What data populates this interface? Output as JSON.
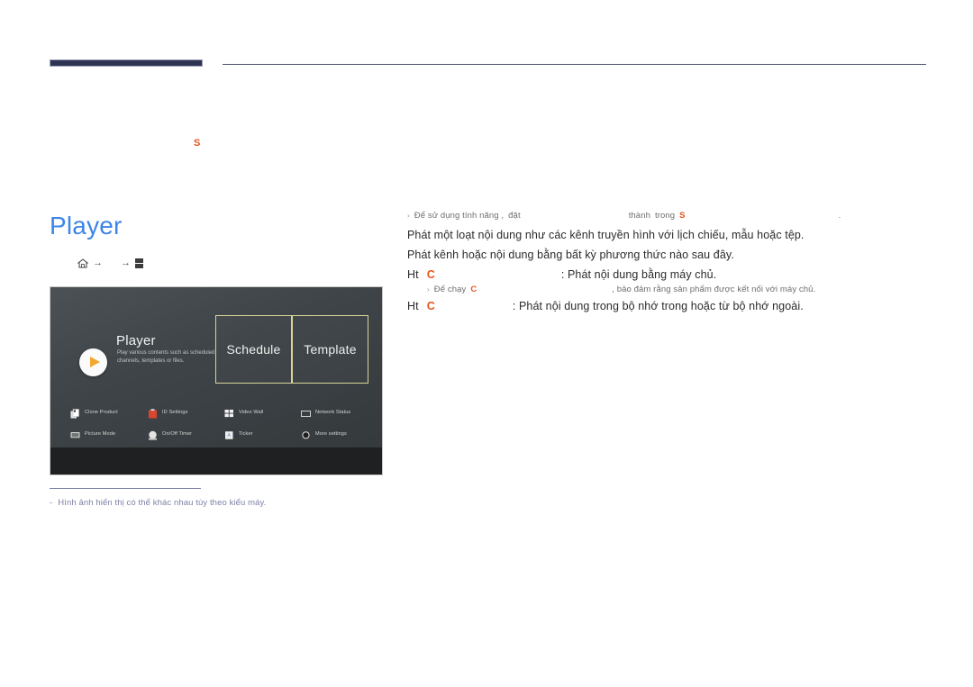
{
  "header": {
    "chapter_mark": "S",
    "bar_color": "#2e3352",
    "rule_color": "#4c5070"
  },
  "page": {
    "title": "Player",
    "title_color": "#3d85e8"
  },
  "breadcrumb": {
    "home_icon": "home-icon",
    "arrow1": "→",
    "arrow2": "→",
    "enter_icon": "enter-key-icon"
  },
  "screenshot": {
    "hero": {
      "title": "Player",
      "description": "Play various contents such as scheduled channels, templates or files.",
      "play_icon": "play-icon"
    },
    "tiles": [
      {
        "label": "Schedule"
      },
      {
        "label": "Template"
      }
    ],
    "grid_items": [
      {
        "label": "Clone Product",
        "icon": "clone-product-icon"
      },
      {
        "label": "ID Settings",
        "icon": "id-settings-icon"
      },
      {
        "label": "Video Wall",
        "icon": "video-wall-icon"
      },
      {
        "label": "Network Status",
        "icon": "network-status-icon"
      },
      {
        "label": "Picture Mode",
        "icon": "picture-mode-icon"
      },
      {
        "label": "On/Off Timer",
        "icon": "on-off-timer-icon"
      },
      {
        "label": "Ticker",
        "icon": "ticker-icon"
      },
      {
        "label": "More settings",
        "icon": "more-settings-icon"
      }
    ],
    "accent_border": "#d8d49a",
    "play_accent": "#f0a830"
  },
  "caption": {
    "dash": "-",
    "text": "Hình ảnh hiển thị có thể khác nhau tùy theo kiểu máy.",
    "color": "#7e82a6"
  },
  "content": {
    "note": {
      "bullet": "›",
      "part1": "Để sử dụng tính năng ,",
      "part2": "đặt",
      "part3": "thành",
      "part4": "trong",
      "highlight": "S",
      "tail": "."
    },
    "paragraphs": [
      "Phát một loạt nội dung như các kênh truyền hình với lịch chiếu, mẫu hoặc tệp.",
      "Phát kênh hoặc nội dung bằng bất kỳ phương thức nào sau đây."
    ],
    "features": [
      {
        "prefix": "Ht",
        "key": "C",
        "rest": ": Phát nội dung bằng máy chủ."
      },
      {
        "prefix": "Ht",
        "key": "C",
        "rest": ": Phát nội dung trong bộ nhớ trong hoặc từ bộ nhớ ngoài."
      }
    ],
    "sub_note": {
      "bullet": "›",
      "prefix": "Để chạy",
      "key": "C",
      "rest": ", bảo đảm rằng sản phẩm được kết nối với máy chủ."
    }
  }
}
